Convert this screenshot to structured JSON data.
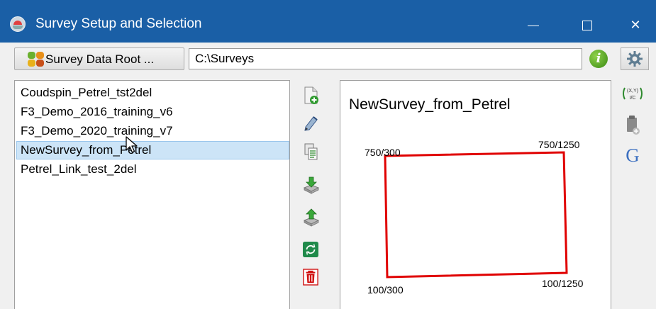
{
  "window": {
    "title": "Survey Setup and Selection",
    "controls": {
      "minimize": "minimize",
      "maximize": "maximize",
      "close": "✕"
    }
  },
  "header": {
    "root_button_label": "Survey Data Root ...",
    "root_path": "C:\\Surveys",
    "info_label": "i",
    "settings_icon": "gear-icon"
  },
  "surveys": {
    "items": [
      "Coudspin_Petrel_tst2del",
      "F3_Demo_2016_training_v6",
      "F3_Demo_2020_training_v7",
      "NewSurvey_from_Petrel",
      "Petrel_Link_test_2del"
    ],
    "selected": "NewSurvey_from_Petrel"
  },
  "toolbar": {
    "icons": [
      "new-survey-icon",
      "edit-survey-icon",
      "copy-survey-icon",
      "import-survey-icon",
      "export-survey-icon",
      "link-survey-icon",
      "delete-survey-icon"
    ]
  },
  "preview": {
    "title": "NewSurvey_from_Petrel",
    "corners": {
      "top_left": "750/300",
      "top_right": "750/1250",
      "bottom_left": "100/300",
      "bottom_right": "100/1250"
    },
    "outline_color": "#e00000"
  },
  "side_tools": {
    "coord_top": "(X,Y)",
    "coord_bottom": "I/C",
    "google_label": "G"
  },
  "colors": {
    "titlebar": "#1a5fa6",
    "selection": "#cce4f7",
    "info_green": "#3a8a14",
    "delete_red": "#d01010"
  }
}
